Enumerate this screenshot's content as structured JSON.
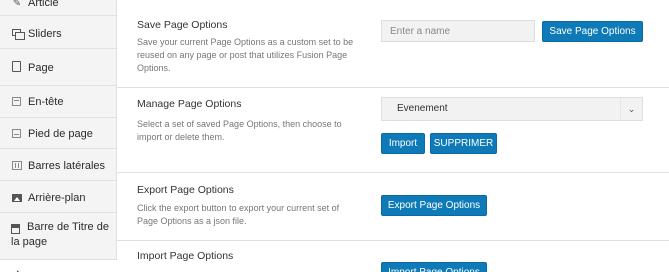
{
  "sidebar": {
    "items": [
      {
        "label": "Article",
        "icon": "pin-icon"
      },
      {
        "label": "Sliders",
        "icon": "slides-icon"
      },
      {
        "label": "Page",
        "icon": "page-icon"
      },
      {
        "label": "En-tête",
        "icon": "header-icon"
      },
      {
        "label": "Pied de page",
        "icon": "footer-icon"
      },
      {
        "label": "Barres latérales",
        "icon": "sidebars-icon"
      },
      {
        "label": "Arrière-plan",
        "icon": "image-icon"
      },
      {
        "label": "Barre de Titre de la page",
        "icon": "title-bar-icon"
      }
    ]
  },
  "save": {
    "title": "Save Page Options",
    "description": "Save your current Page Options as a custom set to be reused on any page or post that utilizes Fusion Page Options.",
    "input_placeholder": "Enter a name",
    "input_value": "",
    "button": "Save Page Options"
  },
  "manage": {
    "title": "Manage Page Options",
    "description": "Select a set of saved Page Options, then choose to import or delete them.",
    "selected": "Evenement",
    "import_button": "Import",
    "delete_button": "SUPPRIMER"
  },
  "export": {
    "title": "Export Page Options",
    "description": "Click the export button to export your current set of Page Options as a json file.",
    "button": "Export Page Options"
  },
  "import": {
    "title": "Import Page Options",
    "button": "Import Page Options"
  },
  "colors": {
    "accent": "#0f7ab8",
    "sidebar_bg": "#f4f4f4",
    "input_bg": "#f2f2f2"
  }
}
